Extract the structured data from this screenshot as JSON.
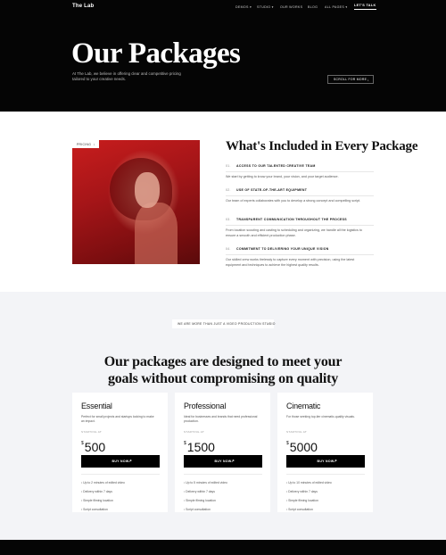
{
  "nav": {
    "logo": "The Lab",
    "items": [
      "DEMOS ▾",
      "STUDIO ▾",
      "OUR WORKS",
      "BLOG",
      "ALL PAGES ▾"
    ],
    "cta": "LET'S TALK"
  },
  "hero": {
    "title": "Our Packages",
    "description": "At The Lab, we believe in offering clear and competitive pricing tailored to your creative needs.",
    "scroll_label": "SCROLL FOR MORE",
    "scroll_icon": "arrow-down"
  },
  "included": {
    "tag": "PRICING",
    "tag_icon": "arrow-down",
    "title": "What's Included in Every Package",
    "features": [
      {
        "num": "01.",
        "title": "ACCESS TO OUR TALENTED CREATIVE TEAM",
        "text": "We start by getting to know your brand, your vision, and your target audience."
      },
      {
        "num": "02.",
        "title": "USE OF STATE-OF-THE-ART EQUIPMENT",
        "text": "Our team of experts collaborates with you to develop a strong concept and compelling script."
      },
      {
        "num": "03.",
        "title": "TRANSPARENT COMMUNICATION THROUGHOUT THE PROCESS",
        "text": "From location scouting and casting to scheduling and organizing, we handle all the logistics to ensure a smooth and efficient production phase."
      },
      {
        "num": "04.",
        "title": "COMMITMENT TO DELIVERING YOUR UNIQUE VISION",
        "text": "Our skilled crew works tirelessly to capture every moment with precision, using the latest equipment and techniques to achieve the highest quality results."
      }
    ]
  },
  "packages": {
    "badge": "WE ARE MORE THAN JUST A VIDEO PRODUCTION STUDIO",
    "badge_icon": "arrow-right",
    "title_line1": "Our packages are designed to meet your",
    "title_line2": "goals without compromising on quality",
    "cards": [
      {
        "name": "Essential",
        "desc": "Perfect for small projects and startups looking to make an impact.",
        "start": "STARTING AT",
        "currency": "$",
        "price": "500",
        "button": "BUY NOW",
        "features": [
          "Up to 2 minutes of edited video",
          "Delivery within 7 days",
          "Simple filming location",
          "Script consultation"
        ]
      },
      {
        "name": "Professional",
        "desc": "Ideal for businesses and brands that need professional production.",
        "start": "STARTING AT",
        "currency": "$",
        "price": "1500",
        "button": "BUY NOW",
        "features": [
          "Up to 5 minutes of edited video",
          "Delivery within 7 days",
          "Simple filming location",
          "Script consultation"
        ]
      },
      {
        "name": "Cinematic",
        "desc": "For those seeking top-tier cinematic-quality visuals.",
        "start": "STARTING AT",
        "currency": "$",
        "price": "5000",
        "button": "BUY NOW",
        "features": [
          "Up to 10 minutes of edited video",
          "Delivery within 7 days",
          "Simple filming location",
          "Script consultation"
        ]
      }
    ]
  },
  "colors": {
    "dark": "#050505",
    "light_bg": "#f3f4f7",
    "accent_red": "#c81d1d"
  }
}
